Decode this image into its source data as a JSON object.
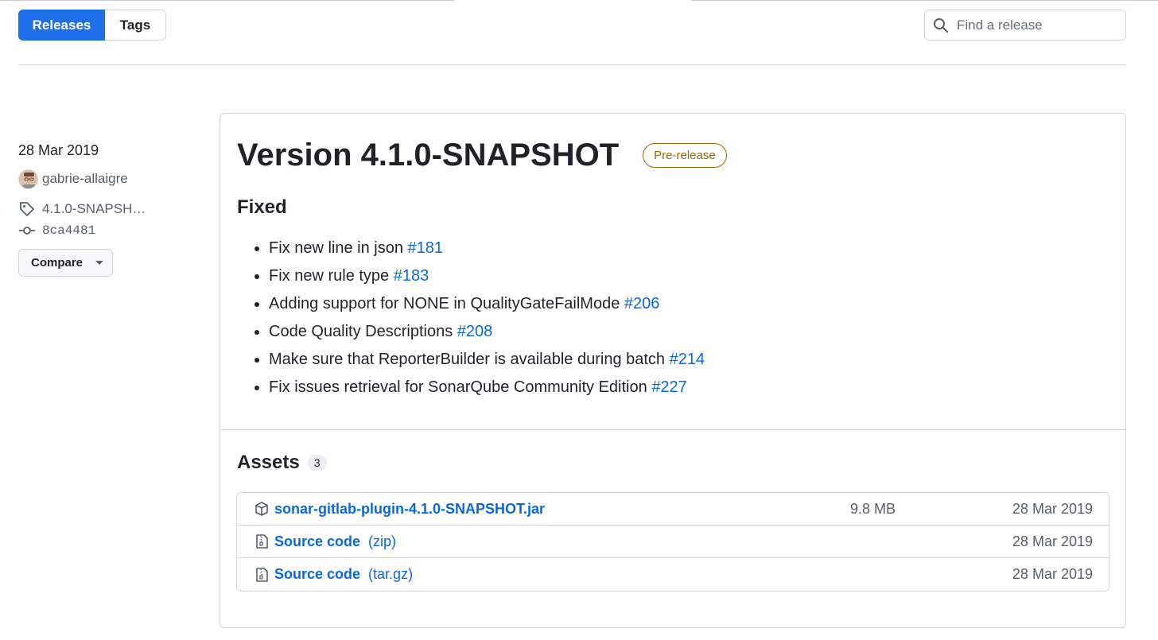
{
  "tabs": {
    "releases": "Releases",
    "tags": "Tags"
  },
  "search": {
    "placeholder": "Find a release"
  },
  "sidebar": {
    "date": "28 Mar 2019",
    "author": "gabrie-allaigre",
    "tag": "4.1.0-SNAPSH…",
    "commit": "8ca4481",
    "compare_label": "Compare"
  },
  "release": {
    "title": "Version 4.1.0-SNAPSHOT",
    "badge": "Pre-release",
    "section_heading": "Fixed",
    "changes": [
      {
        "text": "Fix new line in json ",
        "issue": "#181"
      },
      {
        "text": "Fix new rule type ",
        "issue": "#183"
      },
      {
        "text": "Adding support for NONE in QualityGateFailMode ",
        "issue": "#206"
      },
      {
        "text": "Code Quality Descriptions ",
        "issue": "#208"
      },
      {
        "text": "Make sure that ReporterBuilder is available during batch ",
        "issue": "#214"
      },
      {
        "text": "Fix issues retrieval for SonarQube Community Edition ",
        "issue": "#227"
      }
    ]
  },
  "assets": {
    "heading": "Assets",
    "count": "3",
    "items": [
      {
        "icon": "package-icon",
        "name": "sonar-gitlab-plugin-4.1.0-SNAPSHOT.jar",
        "format": "",
        "size": "9.8 MB",
        "date": "28 Mar 2019"
      },
      {
        "icon": "file-zip-icon",
        "name": "Source code",
        "format": "(zip)",
        "size": "",
        "date": "28 Mar 2019"
      },
      {
        "icon": "file-zip-icon",
        "name": "Source code",
        "format": "(tar.gz)",
        "size": "",
        "date": "28 Mar 2019"
      }
    ]
  },
  "colors": {
    "accent": "#1f6feb",
    "link": "#0969da",
    "prerelease": "#9a6700",
    "border": "#d0d7de",
    "muted": "#57606a"
  }
}
